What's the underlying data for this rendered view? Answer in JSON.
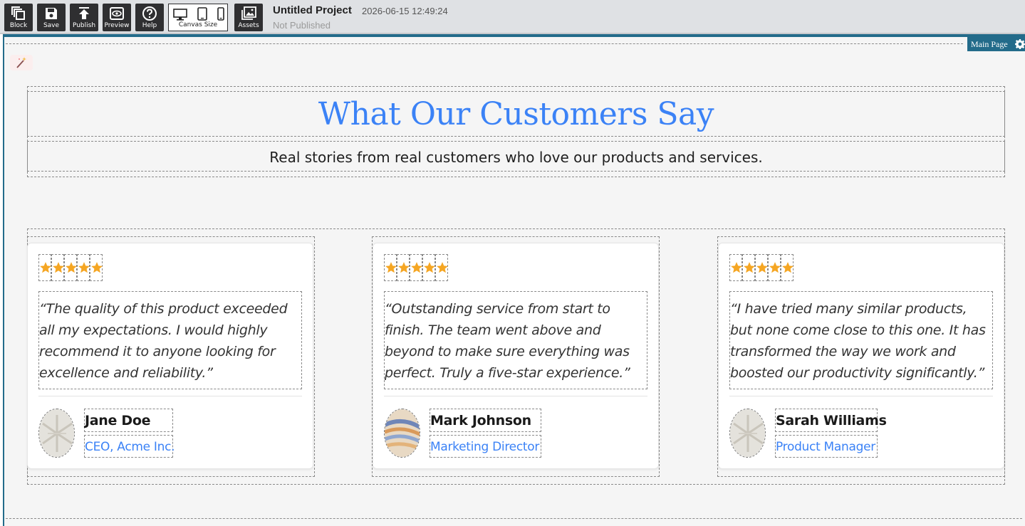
{
  "toolbar": {
    "buttons": {
      "block": "Block",
      "save": "Save",
      "publish": "Publish",
      "preview": "Preview",
      "help": "Help",
      "canvas_size": "Canvas Size",
      "assets": "Assets"
    },
    "project_title": "Untitled Project",
    "timestamp": "2026-06-15 12:49:24",
    "status": "Not Published"
  },
  "page_tab": "Main Page",
  "section": {
    "heading": "What Our Customers Say",
    "subheading": "Real stories from real customers who love our products and services."
  },
  "testimonials": [
    {
      "rating": 5,
      "quote": "“The quality of this product exceeded all my expectations. I would highly recommend it to anyone looking for excellence and reliability.”",
      "name": "Jane Doe",
      "role": "CEO, Acme Inc."
    },
    {
      "rating": 5,
      "quote": "“Outstanding service from start to finish. The team went above and beyond to make sure everything was perfect. Truly a five-star experience.”",
      "name": "Mark Johnson",
      "role": "Marketing Director"
    },
    {
      "rating": 5,
      "quote": "“I have tried many similar products, but none come close to this one. It has transformed the way we work and boosted our productivity significantly.”",
      "name": "Sarah Williams",
      "role": "Product Manager"
    }
  ],
  "colors": {
    "accent": "#3b82f6",
    "star": "#f5a623",
    "frame": "#236b8a",
    "toolbar_button": "#2f2f31"
  }
}
